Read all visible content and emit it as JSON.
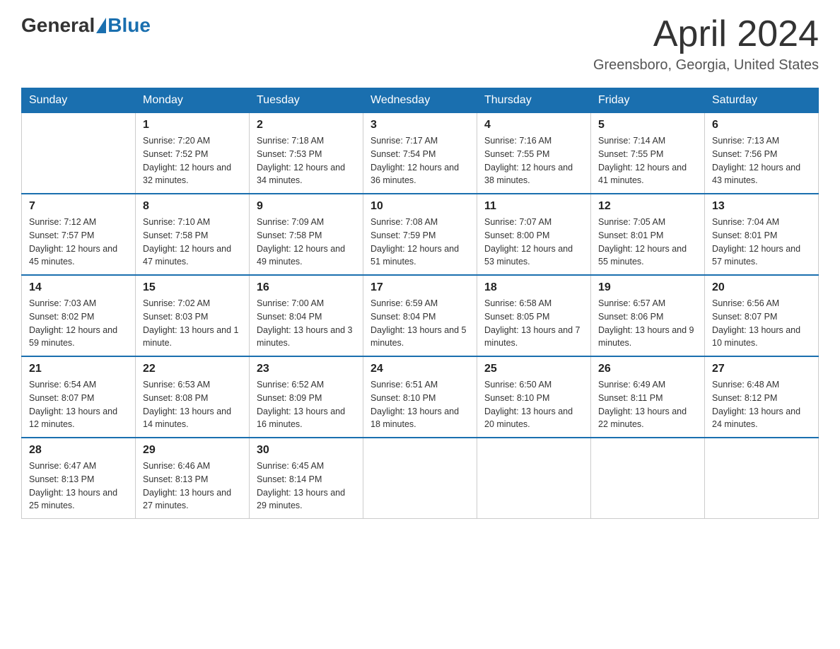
{
  "header": {
    "logo_general": "General",
    "logo_blue": "Blue",
    "title": "April 2024",
    "location": "Greensboro, Georgia, United States"
  },
  "days_of_week": [
    "Sunday",
    "Monday",
    "Tuesday",
    "Wednesday",
    "Thursday",
    "Friday",
    "Saturday"
  ],
  "weeks": [
    [
      {
        "day": "",
        "sunrise": "",
        "sunset": "",
        "daylight": ""
      },
      {
        "day": "1",
        "sunrise": "Sunrise: 7:20 AM",
        "sunset": "Sunset: 7:52 PM",
        "daylight": "Daylight: 12 hours and 32 minutes."
      },
      {
        "day": "2",
        "sunrise": "Sunrise: 7:18 AM",
        "sunset": "Sunset: 7:53 PM",
        "daylight": "Daylight: 12 hours and 34 minutes."
      },
      {
        "day": "3",
        "sunrise": "Sunrise: 7:17 AM",
        "sunset": "Sunset: 7:54 PM",
        "daylight": "Daylight: 12 hours and 36 minutes."
      },
      {
        "day": "4",
        "sunrise": "Sunrise: 7:16 AM",
        "sunset": "Sunset: 7:55 PM",
        "daylight": "Daylight: 12 hours and 38 minutes."
      },
      {
        "day": "5",
        "sunrise": "Sunrise: 7:14 AM",
        "sunset": "Sunset: 7:55 PM",
        "daylight": "Daylight: 12 hours and 41 minutes."
      },
      {
        "day": "6",
        "sunrise": "Sunrise: 7:13 AM",
        "sunset": "Sunset: 7:56 PM",
        "daylight": "Daylight: 12 hours and 43 minutes."
      }
    ],
    [
      {
        "day": "7",
        "sunrise": "Sunrise: 7:12 AM",
        "sunset": "Sunset: 7:57 PM",
        "daylight": "Daylight: 12 hours and 45 minutes."
      },
      {
        "day": "8",
        "sunrise": "Sunrise: 7:10 AM",
        "sunset": "Sunset: 7:58 PM",
        "daylight": "Daylight: 12 hours and 47 minutes."
      },
      {
        "day": "9",
        "sunrise": "Sunrise: 7:09 AM",
        "sunset": "Sunset: 7:58 PM",
        "daylight": "Daylight: 12 hours and 49 minutes."
      },
      {
        "day": "10",
        "sunrise": "Sunrise: 7:08 AM",
        "sunset": "Sunset: 7:59 PM",
        "daylight": "Daylight: 12 hours and 51 minutes."
      },
      {
        "day": "11",
        "sunrise": "Sunrise: 7:07 AM",
        "sunset": "Sunset: 8:00 PM",
        "daylight": "Daylight: 12 hours and 53 minutes."
      },
      {
        "day": "12",
        "sunrise": "Sunrise: 7:05 AM",
        "sunset": "Sunset: 8:01 PM",
        "daylight": "Daylight: 12 hours and 55 minutes."
      },
      {
        "day": "13",
        "sunrise": "Sunrise: 7:04 AM",
        "sunset": "Sunset: 8:01 PM",
        "daylight": "Daylight: 12 hours and 57 minutes."
      }
    ],
    [
      {
        "day": "14",
        "sunrise": "Sunrise: 7:03 AM",
        "sunset": "Sunset: 8:02 PM",
        "daylight": "Daylight: 12 hours and 59 minutes."
      },
      {
        "day": "15",
        "sunrise": "Sunrise: 7:02 AM",
        "sunset": "Sunset: 8:03 PM",
        "daylight": "Daylight: 13 hours and 1 minute."
      },
      {
        "day": "16",
        "sunrise": "Sunrise: 7:00 AM",
        "sunset": "Sunset: 8:04 PM",
        "daylight": "Daylight: 13 hours and 3 minutes."
      },
      {
        "day": "17",
        "sunrise": "Sunrise: 6:59 AM",
        "sunset": "Sunset: 8:04 PM",
        "daylight": "Daylight: 13 hours and 5 minutes."
      },
      {
        "day": "18",
        "sunrise": "Sunrise: 6:58 AM",
        "sunset": "Sunset: 8:05 PM",
        "daylight": "Daylight: 13 hours and 7 minutes."
      },
      {
        "day": "19",
        "sunrise": "Sunrise: 6:57 AM",
        "sunset": "Sunset: 8:06 PM",
        "daylight": "Daylight: 13 hours and 9 minutes."
      },
      {
        "day": "20",
        "sunrise": "Sunrise: 6:56 AM",
        "sunset": "Sunset: 8:07 PM",
        "daylight": "Daylight: 13 hours and 10 minutes."
      }
    ],
    [
      {
        "day": "21",
        "sunrise": "Sunrise: 6:54 AM",
        "sunset": "Sunset: 8:07 PM",
        "daylight": "Daylight: 13 hours and 12 minutes."
      },
      {
        "day": "22",
        "sunrise": "Sunrise: 6:53 AM",
        "sunset": "Sunset: 8:08 PM",
        "daylight": "Daylight: 13 hours and 14 minutes."
      },
      {
        "day": "23",
        "sunrise": "Sunrise: 6:52 AM",
        "sunset": "Sunset: 8:09 PM",
        "daylight": "Daylight: 13 hours and 16 minutes."
      },
      {
        "day": "24",
        "sunrise": "Sunrise: 6:51 AM",
        "sunset": "Sunset: 8:10 PM",
        "daylight": "Daylight: 13 hours and 18 minutes."
      },
      {
        "day": "25",
        "sunrise": "Sunrise: 6:50 AM",
        "sunset": "Sunset: 8:10 PM",
        "daylight": "Daylight: 13 hours and 20 minutes."
      },
      {
        "day": "26",
        "sunrise": "Sunrise: 6:49 AM",
        "sunset": "Sunset: 8:11 PM",
        "daylight": "Daylight: 13 hours and 22 minutes."
      },
      {
        "day": "27",
        "sunrise": "Sunrise: 6:48 AM",
        "sunset": "Sunset: 8:12 PM",
        "daylight": "Daylight: 13 hours and 24 minutes."
      }
    ],
    [
      {
        "day": "28",
        "sunrise": "Sunrise: 6:47 AM",
        "sunset": "Sunset: 8:13 PM",
        "daylight": "Daylight: 13 hours and 25 minutes."
      },
      {
        "day": "29",
        "sunrise": "Sunrise: 6:46 AM",
        "sunset": "Sunset: 8:13 PM",
        "daylight": "Daylight: 13 hours and 27 minutes."
      },
      {
        "day": "30",
        "sunrise": "Sunrise: 6:45 AM",
        "sunset": "Sunset: 8:14 PM",
        "daylight": "Daylight: 13 hours and 29 minutes."
      },
      {
        "day": "",
        "sunrise": "",
        "sunset": "",
        "daylight": ""
      },
      {
        "day": "",
        "sunrise": "",
        "sunset": "",
        "daylight": ""
      },
      {
        "day": "",
        "sunrise": "",
        "sunset": "",
        "daylight": ""
      },
      {
        "day": "",
        "sunrise": "",
        "sunset": "",
        "daylight": ""
      }
    ]
  ]
}
